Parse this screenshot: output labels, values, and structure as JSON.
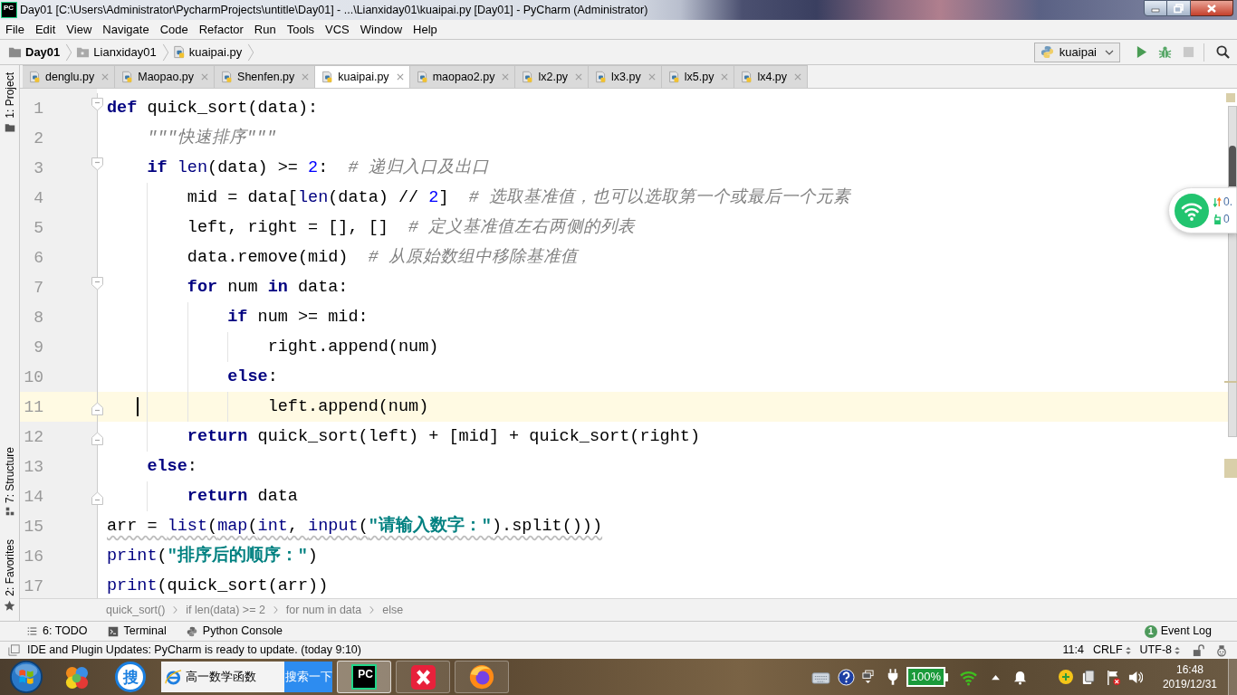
{
  "window": {
    "logo": "PC",
    "title": "Day01 [C:\\Users\\Administrator\\PycharmProjects\\untitle\\Day01] - ...\\Lianxiday01\\kuaipai.py [Day01] - PyCharm (Administrator)"
  },
  "menu": [
    "File",
    "Edit",
    "View",
    "Navigate",
    "Code",
    "Refactor",
    "Run",
    "Tools",
    "VCS",
    "Window",
    "Help"
  ],
  "navigation": {
    "crumbs": [
      {
        "label": "Day01",
        "kind": "project"
      },
      {
        "label": "Lianxiday01",
        "kind": "folder"
      },
      {
        "label": "kuaipai.py",
        "kind": "file"
      }
    ],
    "run_config": "kuaipai"
  },
  "tool_strip": [
    {
      "label": "1: Project",
      "kind": "project"
    },
    {
      "label": "7: Structure",
      "kind": "structure"
    },
    {
      "label": "2: Favorites",
      "kind": "favorites"
    }
  ],
  "tabs": [
    {
      "label": "denglu.py",
      "selected": false
    },
    {
      "label": "Maopao.py",
      "selected": false
    },
    {
      "label": "Shenfen.py",
      "selected": false
    },
    {
      "label": "kuaipai.py",
      "selected": true
    },
    {
      "label": "maopao2.py",
      "selected": false
    },
    {
      "label": "lx2.py",
      "selected": false
    },
    {
      "label": "lx3.py",
      "selected": false
    },
    {
      "label": "lx5.py",
      "selected": false
    },
    {
      "label": "lx4.py",
      "selected": false
    }
  ],
  "editor": {
    "lines": [
      {
        "number": "1",
        "fold_start": true,
        "fold_end": false,
        "current": false,
        "warning": false,
        "tokens": [
          {
            "kind": "keyword",
            "text": "def"
          },
          {
            "kind": "plain",
            "text": " quick_sort(data):"
          }
        ],
        "children": [
          {
            "number": "2",
            "fold_start": false,
            "fold_end": false,
            "current": false,
            "warning": false,
            "tokens": [
              {
                "kind": "docstring",
                "text": "\"\"\"快速排序\"\"\""
              }
            ]
          },
          {
            "number": "3",
            "fold_start": true,
            "fold_end": false,
            "current": false,
            "warning": false,
            "tokens": [
              {
                "kind": "keyword",
                "text": "if "
              },
              {
                "kind": "builtin",
                "text": "len"
              },
              {
                "kind": "plain",
                "text": "(data) >= "
              },
              {
                "kind": "number",
                "text": "2"
              },
              {
                "kind": "plain",
                "text": ":  "
              },
              {
                "kind": "comment",
                "text": "# 递归入口及出口"
              }
            ],
            "children": [
              {
                "number": "4",
                "fold_start": false,
                "fold_end": false,
                "current": false,
                "warning": false,
                "tokens": [
                  {
                    "kind": "plain",
                    "text": "mid = data["
                  },
                  {
                    "kind": "builtin",
                    "text": "len"
                  },
                  {
                    "kind": "plain",
                    "text": "(data) // "
                  },
                  {
                    "kind": "number",
                    "text": "2"
                  },
                  {
                    "kind": "plain",
                    "text": "]  "
                  },
                  {
                    "kind": "comment",
                    "text": "# 选取基准值，也可以选取第一个或最后一个元素"
                  }
                ]
              },
              {
                "number": "5",
                "fold_start": false,
                "fold_end": false,
                "current": false,
                "warning": false,
                "tokens": [
                  {
                    "kind": "plain",
                    "text": "left, right = [], []  "
                  },
                  {
                    "kind": "comment",
                    "text": "# 定义基准值左右两侧的列表"
                  }
                ]
              },
              {
                "number": "6",
                "fold_start": false,
                "fold_end": false,
                "current": false,
                "warning": false,
                "tokens": [
                  {
                    "kind": "plain",
                    "text": "data.remove(mid)  "
                  },
                  {
                    "kind": "comment",
                    "text": "# 从原始数组中移除基准值"
                  }
                ]
              },
              {
                "number": "7",
                "fold_start": true,
                "fold_end": false,
                "current": false,
                "warning": false,
                "tokens": [
                  {
                    "kind": "keyword",
                    "text": "for"
                  },
                  {
                    "kind": "plain",
                    "text": " num "
                  },
                  {
                    "kind": "keyword",
                    "text": "in"
                  },
                  {
                    "kind": "plain",
                    "text": " data:"
                  }
                ],
                "children": [
                  {
                    "number": "8",
                    "fold_start": false,
                    "fold_end": false,
                    "current": false,
                    "warning": false,
                    "tokens": [
                      {
                        "kind": "keyword",
                        "text": "if"
                      },
                      {
                        "kind": "plain",
                        "text": " num >= mid:"
                      }
                    ],
                    "children": [
                      {
                        "number": "9",
                        "fold_start": false,
                        "fold_end": false,
                        "current": false,
                        "warning": false,
                        "tokens": [
                          {
                            "kind": "plain",
                            "text": "right.append(num)"
                          }
                        ]
                      }
                    ]
                  },
                  {
                    "number": "10",
                    "fold_start": false,
                    "fold_end": false,
                    "current": false,
                    "warning": false,
                    "tokens": [
                      {
                        "kind": "keyword",
                        "text": "else"
                      },
                      {
                        "kind": "plain",
                        "text": ":"
                      }
                    ],
                    "children": [
                      {
                        "number": "11",
                        "fold_start": false,
                        "fold_end": true,
                        "current": true,
                        "warning": false,
                        "tokens": [
                          {
                            "kind": "plain",
                            "text": "left.append(num)"
                          }
                        ]
                      }
                    ]
                  }
                ]
              },
              {
                "number": "12",
                "fold_start": false,
                "fold_end": true,
                "current": false,
                "warning": false,
                "tokens": [
                  {
                    "kind": "keyword",
                    "text": "return"
                  },
                  {
                    "kind": "plain",
                    "text": " quick_sort(left) + [mid] + quick_sort(right)"
                  }
                ]
              }
            ]
          },
          {
            "number": "13",
            "fold_start": false,
            "fold_end": false,
            "current": false,
            "warning": false,
            "tokens": [
              {
                "kind": "keyword",
                "text": "else"
              },
              {
                "kind": "plain",
                "text": ":"
              }
            ],
            "children": [
              {
                "number": "14",
                "fold_start": false,
                "fold_end": true,
                "current": false,
                "warning": false,
                "tokens": [
                  {
                    "kind": "keyword",
                    "text": "return"
                  },
                  {
                    "kind": "plain",
                    "text": " data"
                  }
                ]
              }
            ]
          }
        ]
      },
      {
        "number": "15",
        "fold_start": false,
        "fold_end": false,
        "current": false,
        "warning": true,
        "tokens": [
          {
            "kind": "plain",
            "text": "arr = "
          },
          {
            "kind": "builtin",
            "text": "list"
          },
          {
            "kind": "plain",
            "text": "("
          },
          {
            "kind": "builtin",
            "text": "map"
          },
          {
            "kind": "plain",
            "text": "("
          },
          {
            "kind": "builtin",
            "text": "int"
          },
          {
            "kind": "plain",
            "text": ", "
          },
          {
            "kind": "builtin",
            "text": "input"
          },
          {
            "kind": "plain",
            "text": "("
          },
          {
            "kind": "string",
            "text": "\"请输入数字：\""
          },
          {
            "kind": "plain",
            "text": ").split()))"
          }
        ]
      },
      {
        "number": "16",
        "fold_start": false,
        "fold_end": false,
        "current": false,
        "warning": false,
        "tokens": [
          {
            "kind": "builtin",
            "text": "print"
          },
          {
            "kind": "plain",
            "text": "("
          },
          {
            "kind": "string",
            "text": "\"排序后的顺序：\""
          },
          {
            "kind": "plain",
            "text": ")"
          }
        ]
      },
      {
        "number": "17",
        "fold_start": false,
        "fold_end": false,
        "current": false,
        "warning": false,
        "tokens": [
          {
            "kind": "builtin",
            "text": "print"
          },
          {
            "kind": "plain",
            "text": "(quick_sort(arr))"
          }
        ]
      }
    ]
  },
  "network_widget": {
    "readings": [
      "0.",
      "0"
    ]
  },
  "code_breadcrumbs": [
    "quick_sort()",
    "if len(data) >= 2",
    "for num in data",
    "else"
  ],
  "tool_windows": [
    {
      "label": "6: TODO",
      "kind": "todo"
    },
    {
      "label": "Terminal",
      "kind": "terminal"
    },
    {
      "label": "Python Console",
      "kind": "console"
    }
  ],
  "event_log": {
    "label": "Event Log",
    "count": "1"
  },
  "status_bar": {
    "message": "IDE and Plugin Updates: PyCharm is ready to update. (today 9:10)",
    "position": "11:4",
    "line_separator": "CRLF",
    "encoding": "UTF-8"
  },
  "taskbar": {
    "launcher_label": "搜",
    "search": {
      "value": "高一数学函数",
      "button": "搜索一下"
    },
    "apps": [
      {
        "label": "PC",
        "selected": true
      },
      {
        "selected": false
      },
      {
        "selected": false
      }
    ],
    "battery": "100%",
    "time": "16:48",
    "date": "2019/12/31"
  }
}
